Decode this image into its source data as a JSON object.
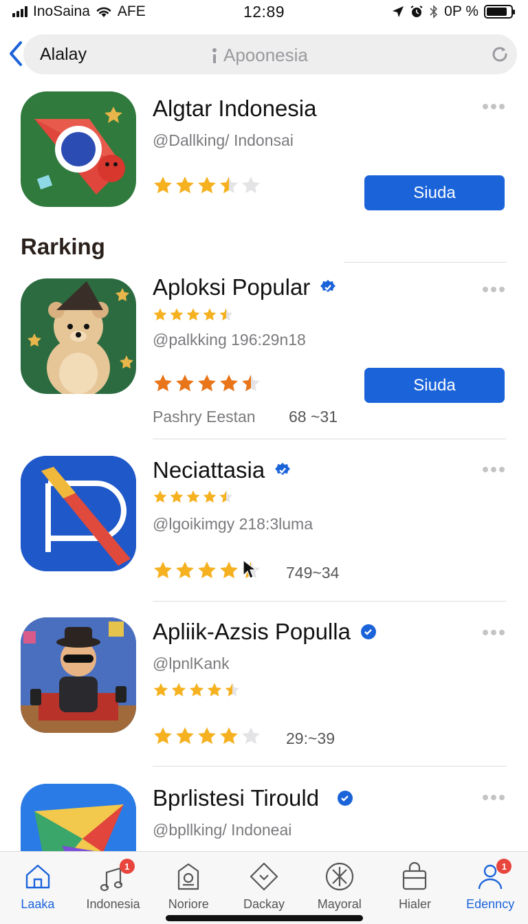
{
  "status": {
    "carrier": "InoSaina",
    "network": "AFE",
    "time": "12:89",
    "battery_text": "0Ρ %",
    "battery_level": 0.85
  },
  "nav": {
    "back_label": "Alalay",
    "search_value": "Apoonesia"
  },
  "featured": {
    "name": "Algtar Indonesia",
    "handle": "@Dallking/ Indonsai",
    "rating": 3.5,
    "button": "Siuda"
  },
  "section_title": "Rarking",
  "apps": [
    {
      "name": "Aploksi Popular",
      "verified": true,
      "rating_small": 4.5,
      "handle": "@palkking 196:29n18",
      "rating": 4.5,
      "button": "Siuda",
      "meta_label": "Pashry Eestan",
      "meta_count": "68 ~31"
    },
    {
      "name": "Neciattasia",
      "verified": true,
      "rating_small": 4.5,
      "handle": "@lgoikimgy 218:3luma",
      "rating": 4.5,
      "meta_count": "749~34"
    },
    {
      "name": "Apliik-Azsis Populla",
      "verified": true,
      "handle": "@lpnlKank",
      "rating_small": 4.5,
      "rating": 4,
      "meta_count": "29:~39"
    },
    {
      "name": "Bprlistesi Tirould",
      "verified": true,
      "handle": "@bpllking/ Indoneai"
    }
  ],
  "tabs": [
    {
      "label": "Laaka",
      "icon": "home-icon",
      "active": true
    },
    {
      "label": "Indonesia",
      "icon": "music-icon",
      "badge": "1"
    },
    {
      "label": "Noriore",
      "icon": "tag-icon"
    },
    {
      "label": "Dackay",
      "icon": "compass-icon"
    },
    {
      "label": "Mayoral",
      "icon": "star-icon"
    },
    {
      "label": "Hialer",
      "icon": "bag-icon"
    },
    {
      "label": "Edenncy",
      "icon": "profile-icon",
      "active": true,
      "badge": "1"
    }
  ],
  "colors": {
    "accent": "#1b63d9",
    "star_gold": "#f5b120",
    "star_orange": "#e8751a",
    "badge": "#e8453c"
  }
}
